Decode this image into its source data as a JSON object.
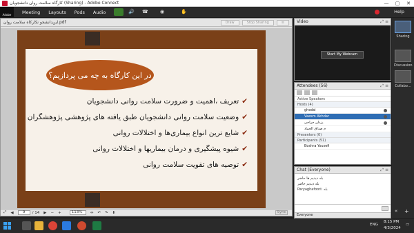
{
  "window": {
    "title": "کارگاه سلامت روان دانشجویان (Sharing) - Adobe Connect",
    "controls": [
      "—",
      "▢",
      "✕"
    ]
  },
  "menu": {
    "logo": "Adobe",
    "items": [
      "Meeting",
      "Layouts",
      "Pods",
      "Audio"
    ],
    "help": "Help"
  },
  "share": {
    "filename": "این‌دانشجو نکارکاه سلامت روان.pdf",
    "draw_label": "Draw",
    "stop_label": "Stop Sharing",
    "page_current": "9",
    "page_total": "/ 14",
    "zoom": "113%",
    "sync_label": "Sync"
  },
  "slide": {
    "heading": "در این کارگاه به چه می پردازیم؟",
    "bullets": [
      "تعریف ،اهمیت و ضرورت سلامت روانی دانشجویان",
      "وضعیت سلامت روانی دانشجویان طبق یافته های پژوهشی پژوهشگران",
      "شایع ترین انواع بیماری‌ها و اختلالات روانی",
      "شیوه پیشگیری و درمان بیماریها و اختلالات روانی",
      "توصیه های تقویت سلامت روانی"
    ]
  },
  "video": {
    "title": "Video",
    "webcam_button": "Start My Webcam"
  },
  "attendees": {
    "title": "Attendees",
    "count": "(56)",
    "active_speakers": "Active Speakers",
    "hosts_label": "Hosts (4)",
    "hosts": [
      "ghodsi",
      "Vaesm Akhdar",
      "یزدان جراحی",
      "م صداق الحماد"
    ],
    "presenters_label": "Presenters (0)",
    "participants_label": "Participants (51)",
    "participants": [
      "Boshra Yousefi"
    ]
  },
  "chat": {
    "title": "Chat",
    "scope": "(Everyone)",
    "messages": [
      "بله دیدیم ها حاضر",
      "بله دیدیم حاضر",
      "Paryaghafoori: بله"
    ],
    "tab": "Everyone"
  },
  "layouts": [
    {
      "label": "Sharing"
    },
    {
      "label": "Discussion"
    },
    {
      "label": "Collabo..."
    }
  ],
  "taskbar": {
    "lang": "ENG",
    "time": "8:15 PM",
    "date": "4/3/2024"
  }
}
